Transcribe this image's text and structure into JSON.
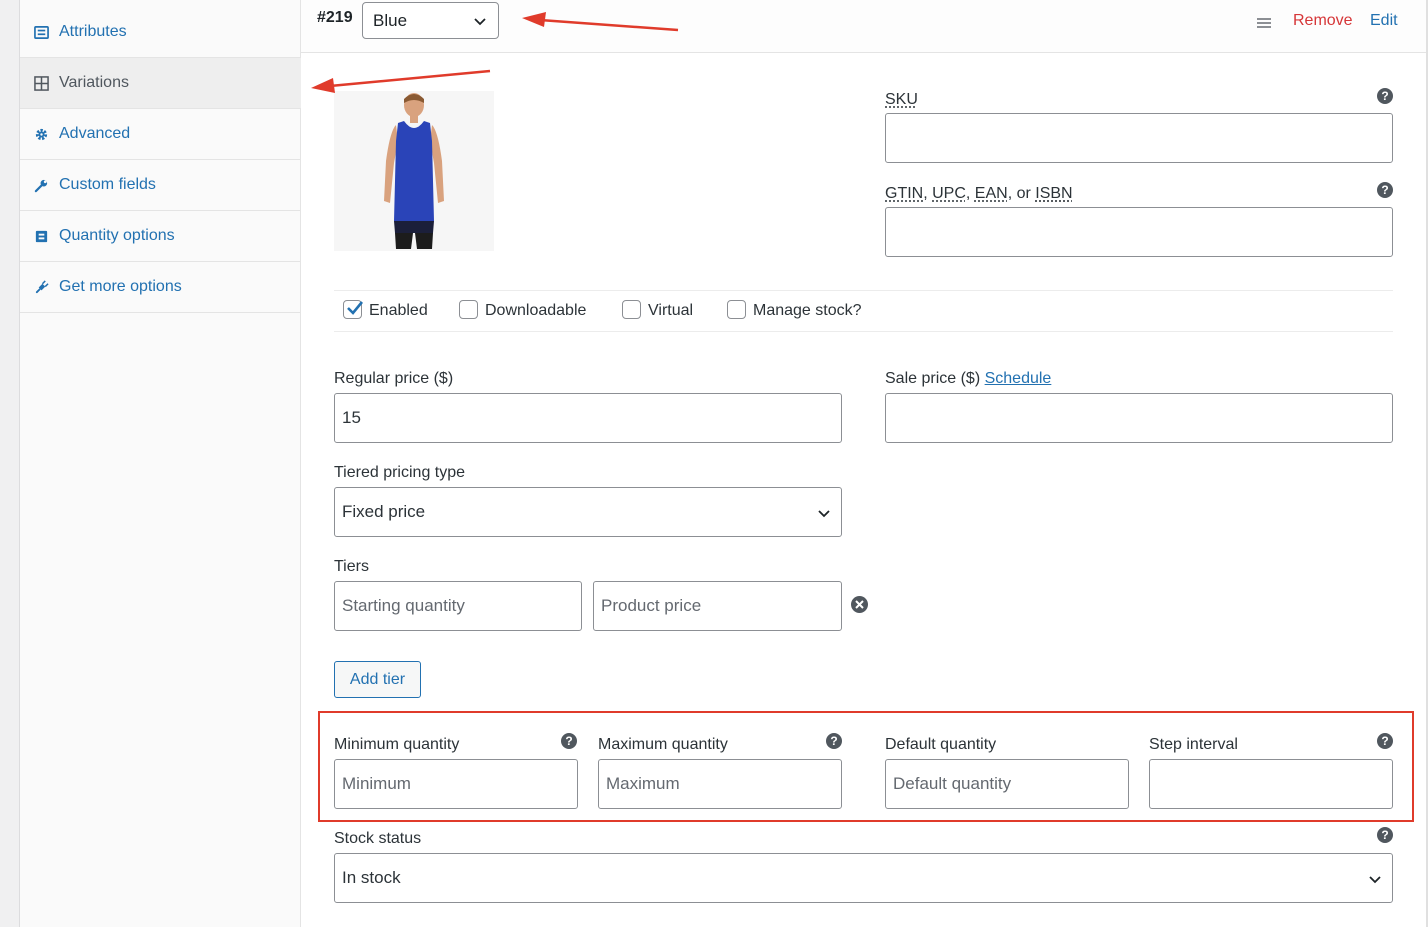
{
  "sidebar": {
    "items": [
      {
        "label": "Attributes",
        "icon": "list-icon",
        "active": false
      },
      {
        "label": "Variations",
        "icon": "grid-icon",
        "active": true
      },
      {
        "label": "Advanced",
        "icon": "gear-icon",
        "active": false
      },
      {
        "label": "Custom fields",
        "icon": "wrench-icon",
        "active": false
      },
      {
        "label": "Quantity options",
        "icon": "box-icon",
        "active": false
      },
      {
        "label": "Get more options",
        "icon": "plugin-icon",
        "active": false
      }
    ]
  },
  "variation": {
    "id": "#219",
    "attribute_value": "Blue",
    "remove_label": "Remove",
    "edit_label": "Edit"
  },
  "fields": {
    "sku_label": "SKU",
    "gtin_label_parts": [
      "GTIN",
      ", ",
      "UPC",
      ", ",
      "EAN",
      ", or ",
      "ISBN"
    ],
    "sku_value": "",
    "gtin_value": "",
    "checkboxes": [
      {
        "label": "Enabled",
        "checked": true
      },
      {
        "label": "Downloadable",
        "checked": false
      },
      {
        "label": "Virtual",
        "checked": false
      },
      {
        "label": "Manage stock?",
        "checked": false
      }
    ],
    "regular_price_label": "Regular price ($)",
    "regular_price_value": "15",
    "sale_price_label": "Sale price ($)",
    "schedule_link": "Schedule",
    "sale_price_value": "",
    "tiered_type_label": "Tiered pricing type",
    "tiered_type_value": "Fixed price",
    "tiers_label": "Tiers",
    "tier_qty_placeholder": "Starting quantity",
    "tier_price_placeholder": "Product price",
    "add_tier_label": "Add tier",
    "min_qty_label": "Minimum quantity",
    "min_qty_placeholder": "Minimum",
    "max_qty_label": "Maximum quantity",
    "max_qty_placeholder": "Maximum",
    "default_qty_label": "Default quantity",
    "default_qty_placeholder": "Default quantity",
    "step_label": "Step interval",
    "step_value": "",
    "stock_status_label": "Stock status",
    "stock_status_value": "In stock"
  },
  "colors": {
    "link": "#2271b1",
    "remove": "#d63638",
    "annotation": "#e03b2b",
    "shirt": "#2a44b8"
  }
}
